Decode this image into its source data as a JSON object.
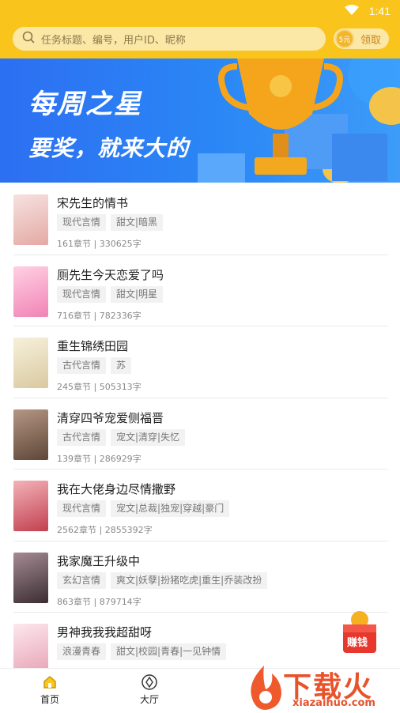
{
  "status": {
    "time": "1:41"
  },
  "search": {
    "placeholder": "任务标题、编号，用户ID、昵称"
  },
  "reward": {
    "coin": "5元",
    "label": "领取"
  },
  "banner": {
    "line1": "每周之星",
    "line2": "要奖，就来大的"
  },
  "books": [
    {
      "title": "宋先生的情书",
      "tags": [
        "现代言情",
        "甜文|暗黑"
      ],
      "meta": "161章节 | 330625字",
      "cover": "#f1d2cf"
    },
    {
      "title": "厕先生今天恋爱了吗",
      "tags": [
        "现代言情",
        "甜文|明星"
      ],
      "meta": "716章节 | 782336字",
      "cover": "#f7b6d2"
    },
    {
      "title": "重生锦绣田园",
      "tags": [
        "古代言情",
        "苏"
      ],
      "meta": "245章节 | 505313字",
      "cover": "#efe6cf"
    },
    {
      "title": "清穿四爷宠爱侧福晋",
      "tags": [
        "古代言情",
        "宠文|清穿|失忆"
      ],
      "meta": "139章节 | 286929字",
      "cover": "#8a6b58"
    },
    {
      "title": "我在大佬身边尽情撒野",
      "tags": [
        "现代言情",
        "宠文|总裁|独宠|穿越|豪门"
      ],
      "meta": "2562章节 | 2855392字",
      "cover": "#d66d78"
    },
    {
      "title": "我家魔王升级中",
      "tags": [
        "玄幻言情",
        "爽文|妖孽|扮猪吃虎|重生|乔装改扮"
      ],
      "meta": "863章节 | 879714字",
      "cover": "#6a5a60"
    },
    {
      "title": "男神我我我超甜呀",
      "tags": [
        "浪漫青春",
        "甜文|校园|青春|一见钟情"
      ],
      "meta": "",
      "cover": "#f5d7df"
    }
  ],
  "float_ad": {
    "label": "赚钱"
  },
  "tabs": [
    {
      "label": "首页"
    },
    {
      "label": "大厅"
    }
  ],
  "watermark": {
    "text": "下载火",
    "url": "xiazaihuo.com"
  }
}
